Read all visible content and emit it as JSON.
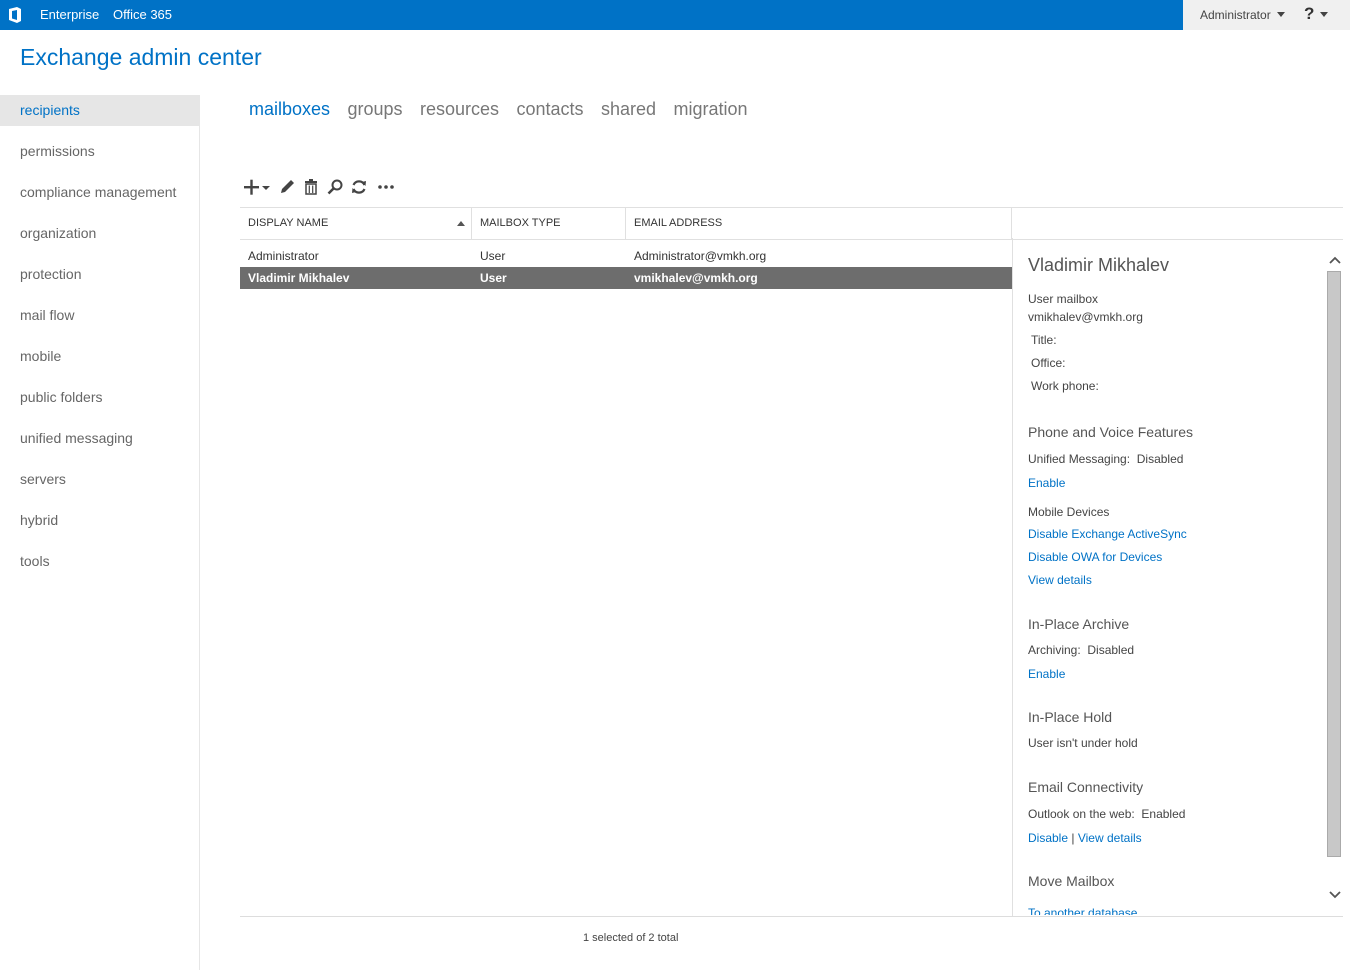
{
  "topbar": {
    "links": [
      "Enterprise",
      "Office 365"
    ],
    "user_menu": "Administrator",
    "help": "?"
  },
  "app_title": "Exchange admin center",
  "sidebar": {
    "items": [
      "recipients",
      "permissions",
      "compliance management",
      "organization",
      "protection",
      "mail flow",
      "mobile",
      "public folders",
      "unified messaging",
      "servers",
      "hybrid",
      "tools"
    ],
    "active": "recipients"
  },
  "tabs": {
    "items": [
      "mailboxes",
      "groups",
      "resources",
      "contacts",
      "shared",
      "migration"
    ],
    "active": "mailboxes"
  },
  "toolbar": {
    "icons": [
      "add-icon",
      "edit-icon",
      "delete-icon",
      "search-icon",
      "refresh-icon",
      "more-icon"
    ]
  },
  "grid": {
    "columns": [
      "DISPLAY NAME",
      "MAILBOX TYPE",
      "EMAIL ADDRESS"
    ],
    "rows": [
      {
        "name": "Administrator",
        "type": "User",
        "email": "Administrator@vmkh.org",
        "selected": false
      },
      {
        "name": "Vladimir Mikhalev",
        "type": "User",
        "email": "vmikhalev@vmkh.org",
        "selected": true
      }
    ],
    "status": "1 selected of 2 total"
  },
  "details": {
    "name": "Vladimir Mikhalev",
    "kind": "User mailbox",
    "email": "vmikhalev@vmkh.org",
    "title_label": "Title:",
    "office_label": "Office:",
    "work_phone_label": "Work phone:",
    "phone_section": "Phone and Voice Features",
    "um_label": "Unified Messaging:",
    "um_value": "Disabled",
    "um_enable": "Enable",
    "mobile_label": "Mobile Devices",
    "disable_eas": "Disable Exchange ActiveSync",
    "disable_owa_devices": "Disable OWA for Devices",
    "view_details": "View details",
    "archive_section": "In-Place Archive",
    "archiving_label": "Archiving:",
    "archiving_value": "Disabled",
    "archive_enable": "Enable",
    "hold_section": "In-Place Hold",
    "hold_text": "User isn't under hold",
    "connectivity_section": "Email Connectivity",
    "owa_label": "Outlook on the web:",
    "owa_value": "Enabled",
    "owa_disable": "Disable",
    "separator": "|",
    "owa_view_details": "View details",
    "move_section": "Move Mailbox",
    "move_link": "To another database"
  },
  "colors": {
    "accent": "#0072c6",
    "selected_row": "#6d6d6d"
  }
}
